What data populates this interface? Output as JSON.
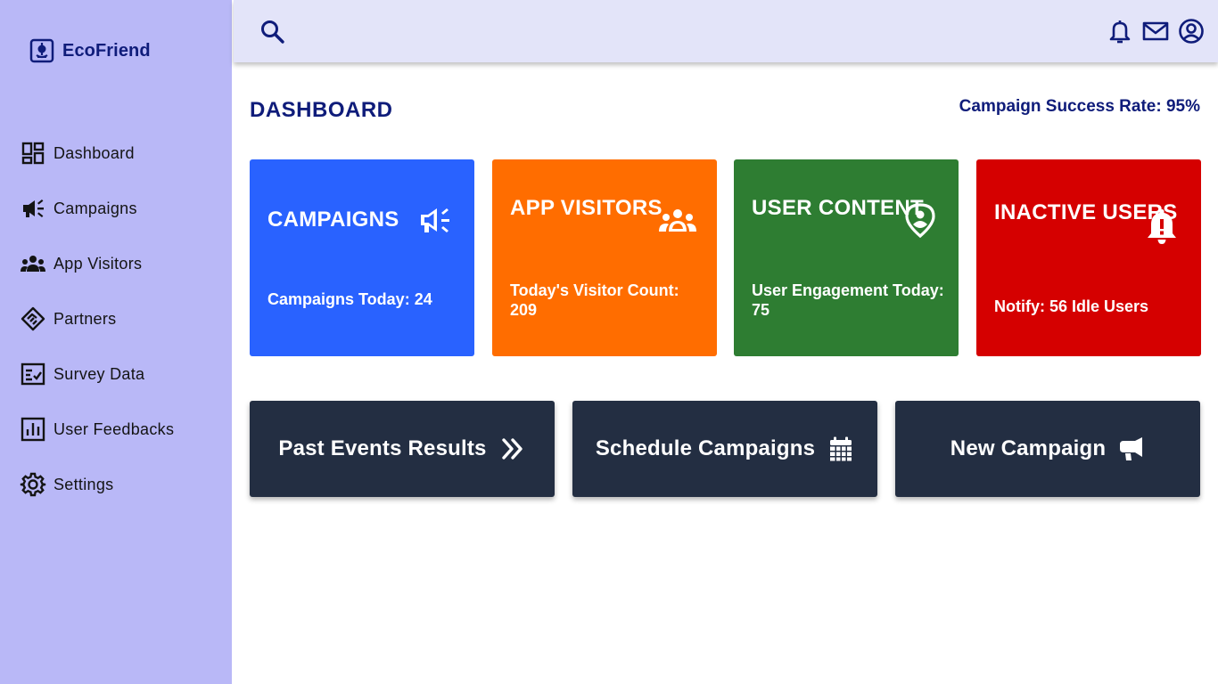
{
  "brand": {
    "name": "EcoFriend",
    "icon": "eco-logo-icon"
  },
  "sidebar": {
    "items": [
      {
        "label": "Dashboard",
        "icon": "dashboard-icon"
      },
      {
        "label": "Campaigns",
        "icon": "megaphone-icon"
      },
      {
        "label": "App Visitors",
        "icon": "group-icon"
      },
      {
        "label": "Partners",
        "icon": "handshake-icon"
      },
      {
        "label": "Survey Data",
        "icon": "survey-icon"
      },
      {
        "label": "User Feedbacks",
        "icon": "bar-chart-icon"
      },
      {
        "label": "Settings",
        "icon": "gear-icon"
      }
    ]
  },
  "topbar": {
    "icons": [
      "search-icon",
      "bell-icon",
      "mail-icon",
      "account-icon"
    ]
  },
  "main": {
    "title": "DASHBOARD",
    "success_rate": "Campaign Success Rate: 95%",
    "cards": [
      {
        "title": "CAMPAIGNS",
        "text": "Campaigns Today: 24",
        "color": "#2962ff",
        "icon": "megaphone-icon"
      },
      {
        "title": "APP VISITORS",
        "text": "Today's Visitor Count: 209",
        "color": "#ff6d00",
        "icon": "group-icon"
      },
      {
        "title": "USER CONTENT",
        "text": "User Engagement Today: 75",
        "color": "#2e7d32",
        "icon": "location-person-icon"
      },
      {
        "title": "INACTIVE USERS",
        "text": "Notify: 56 Idle Users",
        "color": "#d50000",
        "icon": "bell-alert-icon"
      }
    ],
    "actions": [
      {
        "label": "Past Events Results",
        "icon": "double-chevron-right-icon"
      },
      {
        "label": "Schedule Campaigns",
        "icon": "calendar-icon"
      },
      {
        "label": "New Campaign",
        "icon": "megaphone-icon"
      }
    ]
  },
  "colors": {
    "sidebar_bg": "#b9b8f7",
    "topbar_bg": "#e3e4f9",
    "primary_text": "#0f1c7a",
    "action_bg": "#232e42"
  }
}
